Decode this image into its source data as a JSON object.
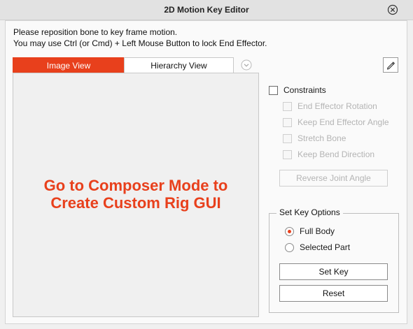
{
  "window": {
    "title": "2D Motion Key Editor",
    "close_icon": "close-circle-icon"
  },
  "instructions": {
    "line1": "Please reposition bone to key frame motion.",
    "line2": "You may use Ctrl (or Cmd) + Left Mouse Button to lock End Effector."
  },
  "tabs": [
    {
      "label": "Image View",
      "active": true
    },
    {
      "label": "Hierarchy View",
      "active": false
    }
  ],
  "view_dropdown_icon": "chevron-down-circle-icon",
  "viewport": {
    "message_line1": "Go to Composer Mode to",
    "message_line2": "Create Custom Rig GUI"
  },
  "pen_tool_icon": "pen-icon",
  "constraints": {
    "label": "Constraints",
    "checked": false,
    "options": [
      {
        "label": "End Effector Rotation",
        "checked": false,
        "enabled": false
      },
      {
        "label": "Keep End Effector Angle",
        "checked": false,
        "enabled": false
      },
      {
        "label": "Stretch Bone",
        "checked": false,
        "enabled": false
      },
      {
        "label": "Keep Bend Direction",
        "checked": false,
        "enabled": false
      }
    ],
    "reverse_button": "Reverse Joint Angle"
  },
  "set_key_options": {
    "legend": "Set Key Options",
    "radios": [
      {
        "label": "Full Body",
        "selected": true
      },
      {
        "label": "Selected Part",
        "selected": false
      }
    ],
    "set_key_button": "Set Key",
    "reset_button": "Reset"
  },
  "colors": {
    "accent": "#e8401c",
    "background": "#f0f0f0",
    "panel": "#fafafa",
    "disabled_text": "#b4b4b4"
  }
}
